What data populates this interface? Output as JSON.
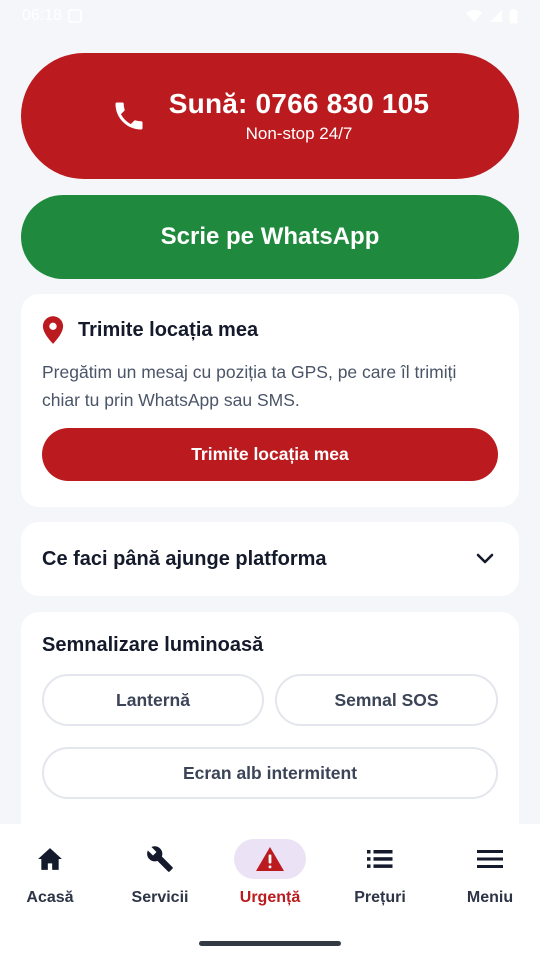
{
  "status_bar": {
    "time": "06:18"
  },
  "call_button": {
    "label": "Sună: 0766 830 105",
    "sublabel": "Non-stop 24/7"
  },
  "whatsapp_button": {
    "label": "Scrie pe WhatsApp"
  },
  "location_card": {
    "title": "Trimite locația mea",
    "description": "Pregătim un mesaj cu poziția ta GPS, pe care îl trimiți chiar tu prin WhatsApp sau SMS.",
    "button_label": "Trimite locația mea"
  },
  "wait_card": {
    "title": "Ce faci până ajunge platforma"
  },
  "light_card": {
    "title": "Semnalizare luminoasă",
    "buttons": [
      "Lanternă",
      "Semnal SOS",
      "Ecran alb intermitent"
    ]
  },
  "bottom_nav": {
    "items": [
      {
        "label": "Acasă",
        "icon": "home-icon"
      },
      {
        "label": "Servicii",
        "icon": "wrench-icon"
      },
      {
        "label": "Urgență",
        "icon": "warning-icon",
        "active": true
      },
      {
        "label": "Prețuri",
        "icon": "list-icon"
      },
      {
        "label": "Meniu",
        "icon": "menu-icon"
      }
    ]
  },
  "colors": {
    "primary_red": "#bb1b1f",
    "whatsapp_green": "#1f8a3e",
    "background": "#f4f6fa",
    "active_nav_pill": "#ebe3f5"
  }
}
